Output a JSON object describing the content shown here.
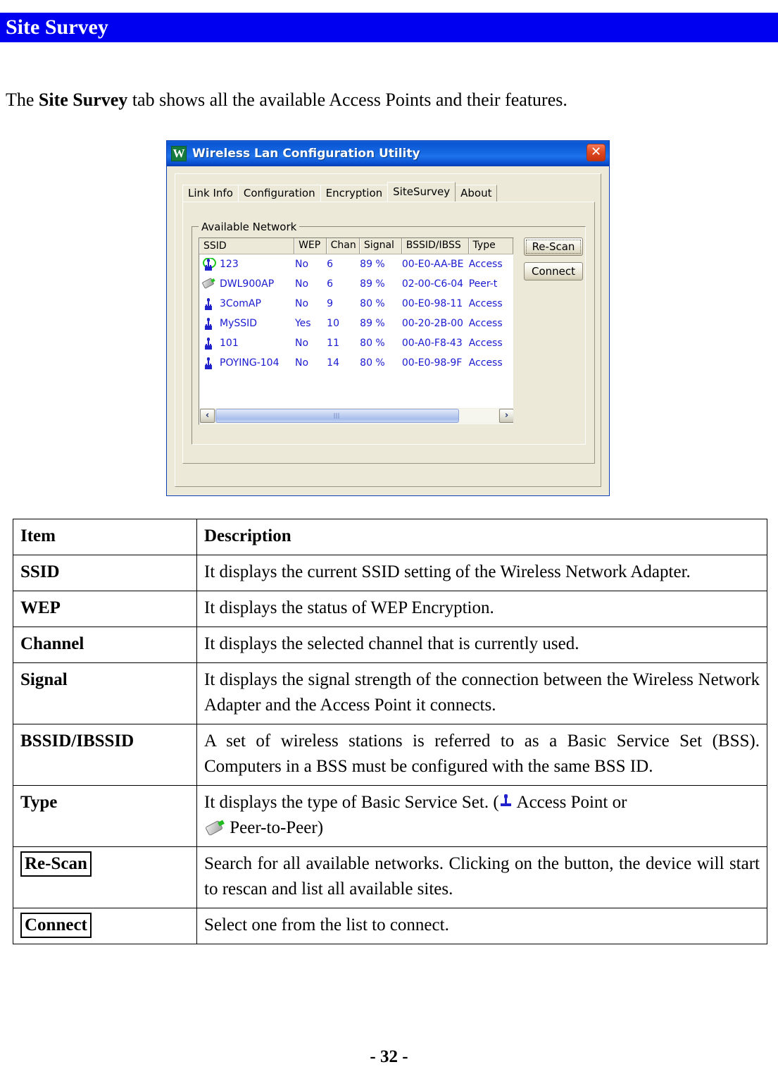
{
  "banner": {
    "title": "Site Survey"
  },
  "intro": {
    "before": "The ",
    "bold": "Site Survey",
    "after": " tab shows all the available Access Points and their features."
  },
  "dialog": {
    "logo_letter": "W",
    "title": "Wireless Lan Configuration Utility",
    "close_label": "✕",
    "tabs": [
      {
        "label": "Link Info",
        "active": false
      },
      {
        "label": "Configuration",
        "active": false
      },
      {
        "label": "Encryption",
        "active": false
      },
      {
        "label": "SiteSurvey",
        "active": true
      },
      {
        "label": "About",
        "active": false
      }
    ],
    "groupbox_label": "Available  Network",
    "columns": [
      "SSID",
      "WEP",
      "Chan",
      "Signal",
      "BSSID/IBSS",
      "Type"
    ],
    "rows": [
      {
        "icon": "access-point-connected-icon",
        "ssid": "123",
        "wep": "No",
        "chan": "6",
        "signal": "89 %",
        "bssid": "00-E0-AA-BE",
        "type": "Access"
      },
      {
        "icon": "peer-to-peer-icon",
        "ssid": "DWL900AP",
        "wep": "No",
        "chan": "6",
        "signal": "89 %",
        "bssid": "02-00-C6-04",
        "type": "Peer-t"
      },
      {
        "icon": "access-point-icon",
        "ssid": "3ComAP",
        "wep": "No",
        "chan": "9",
        "signal": "80 %",
        "bssid": "00-E0-98-11",
        "type": "Access"
      },
      {
        "icon": "access-point-icon",
        "ssid": "MySSID",
        "wep": "Yes",
        "chan": "10",
        "signal": "89 %",
        "bssid": "00-20-2B-00",
        "type": "Access"
      },
      {
        "icon": "access-point-icon",
        "ssid": "101",
        "wep": "No",
        "chan": "11",
        "signal": "80 %",
        "bssid": "00-A0-F8-43",
        "type": "Access"
      },
      {
        "icon": "access-point-icon",
        "ssid": "POYING-104",
        "wep": "No",
        "chan": "14",
        "signal": "80 %",
        "bssid": "00-E0-98-9F",
        "type": "Access"
      }
    ],
    "buttons": {
      "rescan": "Re-Scan",
      "connect": "Connect"
    },
    "scrollbar": {
      "left_arrow": "‹",
      "right_arrow": "›"
    }
  },
  "desc_table": {
    "header": {
      "item": "Item",
      "description": "Description"
    },
    "rows": [
      {
        "item": "SSID",
        "description": "It displays the current SSID setting of the Wireless Network Adapter."
      },
      {
        "item": "WEP",
        "description": "It displays the status of WEP Encryption."
      },
      {
        "item": "Channel",
        "description": "It displays the selected channel that is currently used."
      },
      {
        "item": "Signal",
        "description": "It displays the signal strength of the connection between the Wireless Network Adapter and the Access Point it connects."
      },
      {
        "item": "BSSID/IBSSID",
        "description": "A set of wireless stations is referred to as a Basic Service Set (BSS). Computers in a BSS must be configured with the same BSS ID."
      }
    ],
    "type_row": {
      "item": "Type",
      "text_before_ap_icon": "It displays the type of Basic Service Set. (",
      "text_after_ap_icon": " Access Point or",
      "text_after_peer_icon": " Peer-to-Peer)"
    },
    "rescan_row": {
      "item": "Re-Scan",
      "description": "Search for all available networks. Clicking on the button, the device will start to rescan and list all available sites."
    },
    "connect_row": {
      "item": "Connect",
      "description": "Select one from the list to connect."
    }
  },
  "footer": {
    "page": "- 32 -"
  }
}
